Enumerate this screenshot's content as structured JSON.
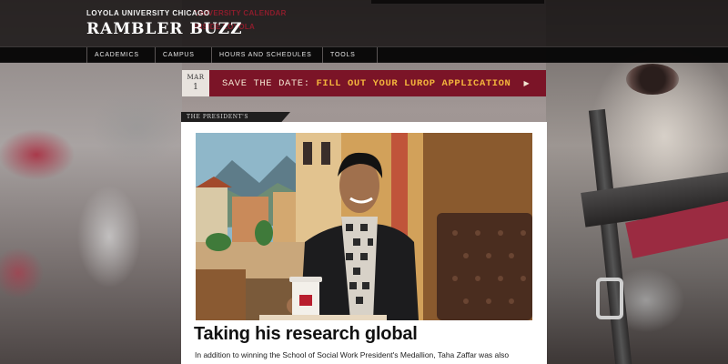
{
  "header": {
    "university": "LOYOLA UNIVERSITY CHICAGO",
    "title": "RAMBLER BUZZ",
    "links": [
      "UNIVERSITY CALENDAR",
      "INSIDE LOYOLA"
    ]
  },
  "nav": {
    "items": [
      "ACADEMICS",
      "CAMPUS",
      "HOURS AND SCHEDULES",
      "TOOLS"
    ]
  },
  "announcement": {
    "month": "MAR",
    "day": "1",
    "prefix": "SAVE THE DATE:",
    "highlight": "FILL OUT YOUR LUROP APPLICATION",
    "arrow_icon": "chevron-right-icon"
  },
  "article": {
    "tag": "THE PRESIDENT'S MEDALLION",
    "headline": "Taking his research global",
    "excerpt": "In addition to winning the School of Social Work President's Medallion, Taha Zaffar was also"
  },
  "colors": {
    "brand_maroon": "#7b1427",
    "banner_highlight": "#f3b43c",
    "header_bg": "#141010"
  }
}
